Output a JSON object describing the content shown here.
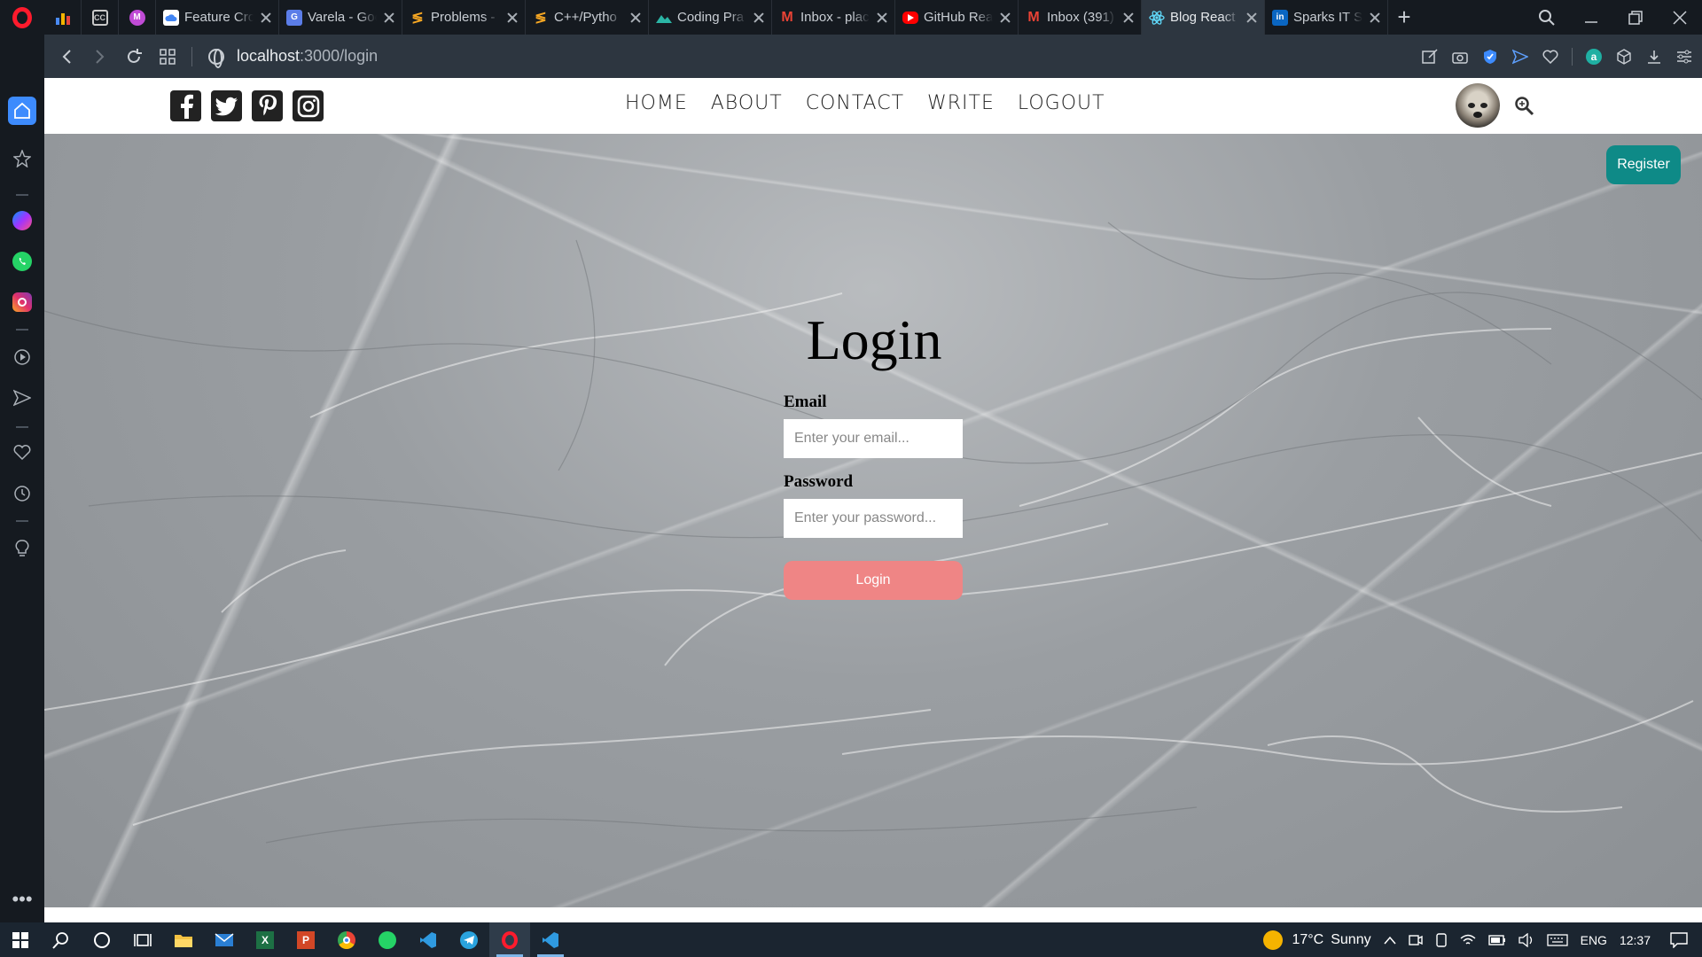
{
  "browser": {
    "tabs": [
      {
        "title": "",
        "icon": "analytics-icon",
        "color": "#4a8bf5"
      },
      {
        "title": "",
        "icon": "cc-icon",
        "color": "#c9c9c9"
      },
      {
        "title": "",
        "icon": "m-avatar-icon",
        "color": "#c04bd6"
      },
      {
        "title": "Feature Cro",
        "icon": "cloud-icon",
        "color": "#4285f4"
      },
      {
        "title": "Varela - Goo",
        "icon": "fonts-icon",
        "color": "#5b7de8"
      },
      {
        "title": "Problems -",
        "icon": "stack-icon",
        "color": "#f5a623"
      },
      {
        "title": "C++/Pytho",
        "icon": "stack-icon",
        "color": "#f5a623"
      },
      {
        "title": "Coding Pra",
        "icon": "mountain-icon",
        "color": "#2bb5a5"
      },
      {
        "title": "Inbox - plac",
        "icon": "gmail-icon",
        "color": "#ea4335"
      },
      {
        "title": "GitHub Rea",
        "icon": "youtube-icon",
        "color": "#ff0000"
      },
      {
        "title": "Inbox (391)",
        "icon": "gmail-icon",
        "color": "#ea4335"
      },
      {
        "title": "Blog React",
        "icon": "react-icon",
        "color": "#61dafb"
      },
      {
        "title": "Sparks IT So",
        "icon": "linkedin-icon",
        "color": "#0a66c2"
      }
    ],
    "url_host": "localhost",
    "url_path": ":3000/login"
  },
  "site": {
    "menu": [
      "HOME",
      "ABOUT",
      "CONTACT",
      "WRITE",
      "LOGOUT"
    ],
    "register_label": "Register",
    "login": {
      "title": "Login",
      "email_label": "Email",
      "email_placeholder": "Enter your email...",
      "password_label": "Password",
      "password_placeholder": "Enter your password...",
      "button_label": "Login"
    }
  },
  "taskbar": {
    "temperature": "17°C",
    "weather": "Sunny",
    "language": "ENG",
    "time": "12:37"
  },
  "colors": {
    "register_bg": "#0e8a87",
    "login_button_bg": "#ef8585",
    "opera_red": "#ff1b2d"
  }
}
